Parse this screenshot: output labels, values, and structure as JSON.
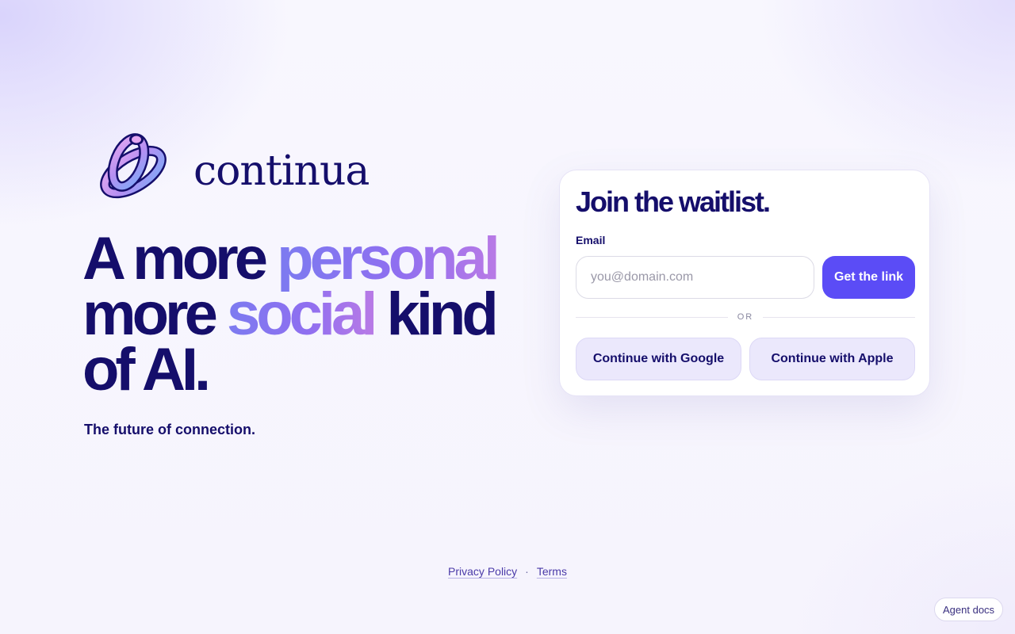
{
  "brand": {
    "name": "continua",
    "logo_icon": "knot-snake-icon"
  },
  "hero": {
    "line1_plain": "A more ",
    "line1_highlight": "personal",
    "line2_plain_start": "more ",
    "line2_highlight": "social",
    "line2_plain_end": " kind",
    "line3": "of AI.",
    "tagline": "The future of connection."
  },
  "waitlist": {
    "title": "Join the waitlist.",
    "email_label": "Email",
    "email_placeholder": "you@domain.com",
    "email_value": "",
    "submit_label": "Get the link",
    "divider_text": "OR",
    "google_label": "Continue with Google",
    "apple_label": "Continue with Apple"
  },
  "footer": {
    "privacy_label": "Privacy Policy",
    "separator": "·",
    "terms_label": "Terms"
  },
  "agent_docs_label": "Agent docs",
  "colors": {
    "primary_text": "#150e6b",
    "accent_button": "#5b4cf6",
    "secondary_button_bg": "#ebe8fc",
    "gradient_start": "#7c7bf0",
    "gradient_end": "#b87ae6"
  }
}
